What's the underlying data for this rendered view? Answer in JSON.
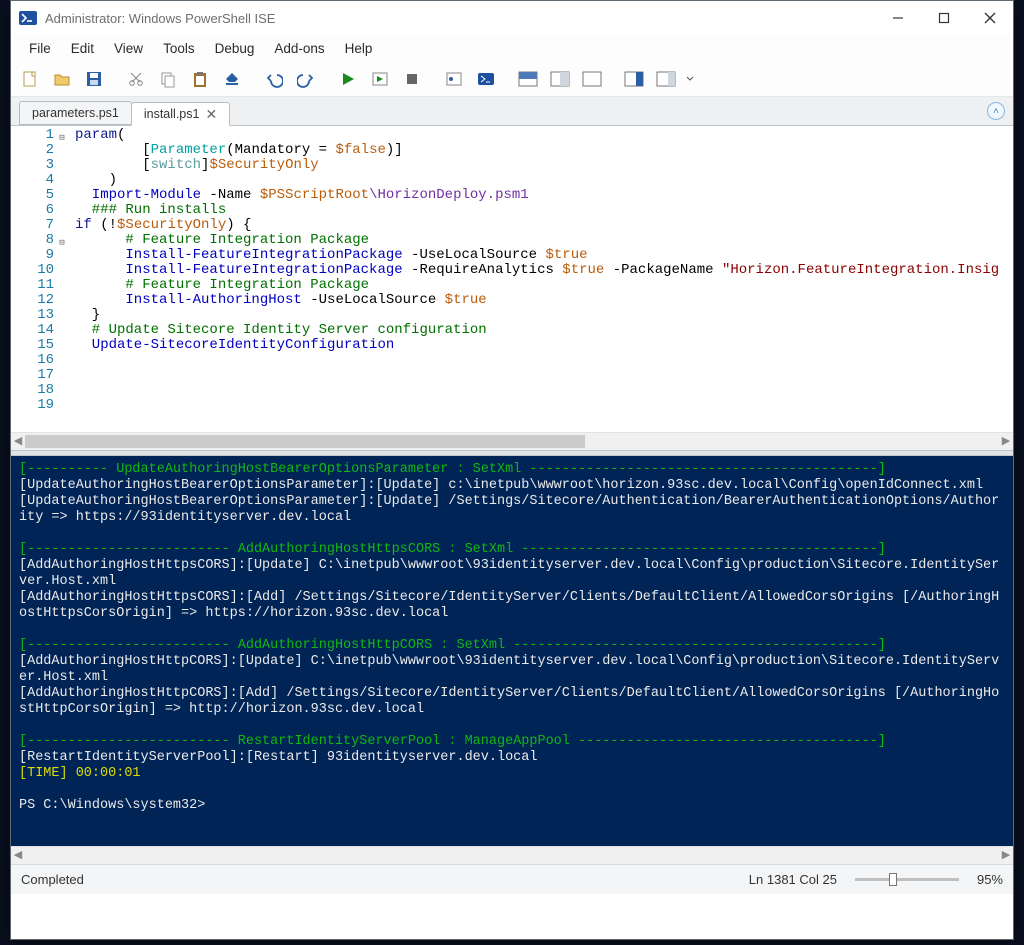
{
  "window": {
    "title": "Administrator: Windows PowerShell ISE"
  },
  "menus": [
    "File",
    "Edit",
    "View",
    "Tools",
    "Debug",
    "Add-ons",
    "Help"
  ],
  "toolbar_icons": [
    "new-icon",
    "open-icon",
    "save-icon",
    "cut-icon",
    "copy-icon",
    "paste-icon",
    "clear-icon",
    "undo-icon",
    "redo-icon",
    "run-icon",
    "run-selection-icon",
    "stop-icon",
    "breakpoint-icon",
    "powershell-icon",
    "layout-script-top-icon",
    "layout-side-icon",
    "layout-full-icon",
    "command-addon-icon",
    "command-pane-icon"
  ],
  "tabs": [
    {
      "label": "parameters.ps1",
      "active": false
    },
    {
      "label": "install.ps1",
      "active": true
    }
  ],
  "code": {
    "lines": [
      {
        "n": 1,
        "fold": "-",
        "tokens": [
          [
            "kw",
            "param"
          ],
          [
            "",
            "("
          ]
        ]
      },
      {
        "n": 2,
        "tokens": [
          [
            "",
            "        ["
          ],
          [
            "attr",
            "Parameter"
          ],
          [
            "",
            "(Mandatory = "
          ],
          [
            "var",
            "$false"
          ],
          [
            "",
            ")]"
          ]
        ]
      },
      {
        "n": 3,
        "tokens": [
          [
            "",
            "        ["
          ],
          [
            "ps-type",
            "switch"
          ],
          [
            "",
            "]"
          ],
          [
            "var",
            "$SecurityOnly"
          ]
        ]
      },
      {
        "n": 4,
        "tokens": [
          [
            "",
            "    )"
          ]
        ]
      },
      {
        "n": 5,
        "tokens": [
          [
            "",
            ""
          ]
        ]
      },
      {
        "n": 6,
        "tokens": [
          [
            "cmd",
            "  Import-Module"
          ],
          [
            "",
            " -Name "
          ],
          [
            "var",
            "$PSScriptRoot"
          ],
          [
            "path-piece",
            "\\HorizonDeploy.psm1"
          ]
        ]
      },
      {
        "n": 7,
        "tokens": [
          [
            "cmt",
            "  ### Run installs"
          ]
        ]
      },
      {
        "n": 8,
        "fold": "-",
        "tokens": [
          [
            "kw",
            "if"
          ],
          [
            "",
            " (!"
          ],
          [
            "var",
            "$SecurityOnly"
          ],
          [
            "",
            ") {"
          ]
        ]
      },
      {
        "n": 9,
        "tokens": [
          [
            "cmt",
            "      # Feature Integration Package"
          ]
        ]
      },
      {
        "n": 10,
        "tokens": [
          [
            "cmd",
            "      Install-FeatureIntegrationPackage"
          ],
          [
            "",
            " -UseLocalSource "
          ],
          [
            "var",
            "$true"
          ]
        ]
      },
      {
        "n": 11,
        "tokens": [
          [
            "",
            ""
          ]
        ]
      },
      {
        "n": 12,
        "tokens": [
          [
            "cmd",
            "      Install-FeatureIntegrationPackage"
          ],
          [
            "",
            " -RequireAnalytics "
          ],
          [
            "var",
            "$true"
          ],
          [
            "",
            " -PackageName "
          ],
          [
            "str",
            "\"Horizon.FeatureIntegration.Insig"
          ]
        ]
      },
      {
        "n": 13,
        "tokens": [
          [
            "",
            ""
          ]
        ]
      },
      {
        "n": 14,
        "tokens": [
          [
            "cmt",
            "      # Feature Integration Package"
          ]
        ]
      },
      {
        "n": 15,
        "tokens": [
          [
            "cmd",
            "      Install-AuthoringHost"
          ],
          [
            "",
            " -UseLocalSource "
          ],
          [
            "var",
            "$true"
          ]
        ]
      },
      {
        "n": 16,
        "tokens": [
          [
            "",
            "  }"
          ]
        ]
      },
      {
        "n": 17,
        "tokens": [
          [
            "cmt",
            "  # Update Sitecore Identity Server configuration"
          ]
        ]
      },
      {
        "n": 18,
        "tokens": [
          [
            "cmd",
            "  Update-SitecoreIdentityConfiguration"
          ]
        ]
      },
      {
        "n": 19,
        "tokens": [
          [
            "",
            ""
          ]
        ]
      }
    ]
  },
  "console": {
    "blocks": [
      {
        "type": "hdr",
        "text": "[---------- UpdateAuthoringHostBearerOptionsParameter : SetXml -------------------------------------------]"
      },
      {
        "type": "txt",
        "text": "[UpdateAuthoringHostBearerOptionsParameter]:[Update] c:\\inetpub\\wwwroot\\horizon.93sc.dev.local\\Config\\openIdConnect.xml"
      },
      {
        "type": "txt",
        "text": "[UpdateAuthoringHostBearerOptionsParameter]:[Update] /Settings/Sitecore/Authentication/BearerAuthenticationOptions/Authority => https://93identityserver.dev.local"
      },
      {
        "type": "blank",
        "text": ""
      },
      {
        "type": "hdr",
        "text": "[------------------------- AddAuthoringHostHttpsCORS : SetXml --------------------------------------------]"
      },
      {
        "type": "txt",
        "text": "[AddAuthoringHostHttpsCORS]:[Update] C:\\inetpub\\wwwroot\\93identityserver.dev.local\\Config\\production\\Sitecore.IdentityServer.Host.xml"
      },
      {
        "type": "txt",
        "text": "[AddAuthoringHostHttpsCORS]:[Add] /Settings/Sitecore/IdentityServer/Clients/DefaultClient/AllowedCorsOrigins [/AuthoringHostHttpsCorsOrigin] => https://horizon.93sc.dev.local"
      },
      {
        "type": "blank",
        "text": ""
      },
      {
        "type": "hdr",
        "text": "[------------------------- AddAuthoringHostHttpCORS : SetXml ---------------------------------------------]"
      },
      {
        "type": "txt",
        "text": "[AddAuthoringHostHttpCORS]:[Update] C:\\inetpub\\wwwroot\\93identityserver.dev.local\\Config\\production\\Sitecore.IdentityServer.Host.xml"
      },
      {
        "type": "txt",
        "text": "[AddAuthoringHostHttpCORS]:[Add] /Settings/Sitecore/IdentityServer/Clients/DefaultClient/AllowedCorsOrigins [/AuthoringHostHttpCorsOrigin] => http://horizon.93sc.dev.local"
      },
      {
        "type": "blank",
        "text": ""
      },
      {
        "type": "hdr",
        "text": "[------------------------- RestartIdentityServerPool : ManageAppPool -------------------------------------]"
      },
      {
        "type": "txt",
        "text": "[RestartIdentityServerPool]:[Restart] 93identityserver.dev.local"
      },
      {
        "type": "ylw",
        "text": "[TIME] 00:00:01"
      },
      {
        "type": "blank",
        "text": ""
      },
      {
        "type": "txt",
        "text": "PS C:\\Windows\\system32> "
      }
    ]
  },
  "status": {
    "left": "Completed",
    "pos": "Ln 1381  Col 25",
    "zoom": "95%"
  }
}
